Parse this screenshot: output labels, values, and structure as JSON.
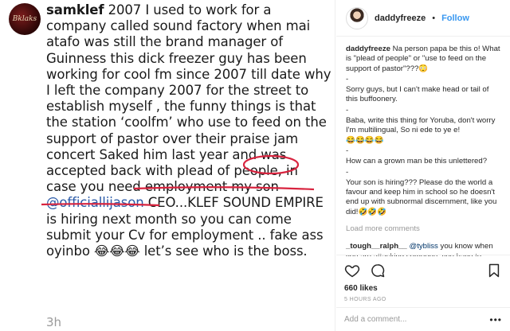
{
  "image_comment": {
    "avatar_text": "Bklaks",
    "username": "samklef",
    "text_1": " 2007 I used to work for a company called sound factory when mai atafo was still the brand manager of Guinness this dick freezer guy has been working for cool fm since 2007 till date why I left the company 2007 for the street to establish myself , the funny things is that the station ‘coolfm’ who use to feed on the support of pastor over their praise jam concert ",
    "circled_word": "Saked",
    "text_2": " him last year and ",
    "underlined_1": "was accepted back with",
    "text_3": " ",
    "underlined_2": "plead of people,",
    "text_4": " in case you need employment my son ",
    "mention": "@officiallijason",
    "text_5": " CEO...KLEF SOUND EMPIRE is hiring next month so you can come submit your Cv for employment .. fake ass oyinbo 😂😂😂  let’s see who is the boss.",
    "time": "3h",
    "mark_color": "#d8243f"
  },
  "post": {
    "header": {
      "username": "daddyfreeze",
      "dot": "•",
      "follow_label": "Follow"
    },
    "caption": {
      "username": "daddyfreeze",
      "text": " Na person papa be this o! What is \"plead of people\" or \"use to feed on the support of pastor\"???😳"
    },
    "caption_lines": [
      "-",
      "Sorry guys, but I can't make head or tail of this buffoonery.",
      "-",
      "Baba, write this thing for Yoruba, don't worry I'm multilingual, So ni ede to ye e!",
      "😂😂😂😂",
      "-",
      "How can a grown man be this unlettered?",
      "-",
      "Your son is hiring??? Please do the world a favour and keep him in school so he doesn't end up with subnormal discernment, like you did!🤣🤣🤣"
    ],
    "load_more": "Load more comments",
    "reply": {
      "username": "_tough__ralph__",
      "mention": "@tybliss",
      "text": " you know when you are attacking someone, you have to"
    },
    "likes": "660 likes",
    "time_ago": "5 HOURS AGO",
    "comment_placeholder": "Add a comment...",
    "more_label": "•••",
    "icons": [
      "heart-icon",
      "comment-icon",
      "bookmark-icon"
    ]
  }
}
